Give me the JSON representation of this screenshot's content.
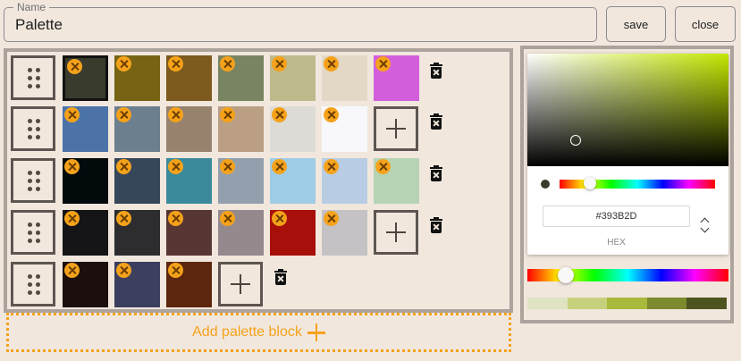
{
  "name_field": {
    "label": "Name",
    "value": "Palette"
  },
  "buttons": {
    "save": "save",
    "close": "close"
  },
  "palette_rows": [
    {
      "swatches": [
        "#393B2D",
        "#766414",
        "#7D5A1D",
        "#798562",
        "#BEBA8C",
        "#E3D8C6",
        "#D35EDC"
      ],
      "selected": 0,
      "has_add": false
    },
    {
      "swatches": [
        "#4B73A8",
        "#6B7F8E",
        "#97826E",
        "#BA9F84",
        "#DCDBD6",
        "#F8F8FC"
      ],
      "selected": -1,
      "has_add": true
    },
    {
      "swatches": [
        "#020A0C",
        "#36475A",
        "#3A8A9C",
        "#949FAD",
        "#9FCCE6",
        "#B8CDE3",
        "#B6D4B4"
      ],
      "selected": -1,
      "has_add": false
    },
    {
      "swatches": [
        "#151517",
        "#2D2D2F",
        "#583634",
        "#948A8E",
        "#A70F0A",
        "#C4C2C5"
      ],
      "selected": -1,
      "has_add": true
    },
    {
      "swatches": [
        "#1B0E0C",
        "#3D3F5E",
        "#5D260E"
      ],
      "selected": -1,
      "has_add": true
    }
  ],
  "add_block_label": "Add palette block",
  "picker": {
    "hex": "#393B2D",
    "hex_label": "HEX",
    "hue_color": "#C4E600",
    "shades": [
      "#DFE3C1",
      "#C7D17D",
      "#A9B93C",
      "#7E8A2E",
      "#4E5420"
    ]
  },
  "colors": {
    "accent": "#F5A21B",
    "background": "#F1E7DD"
  }
}
